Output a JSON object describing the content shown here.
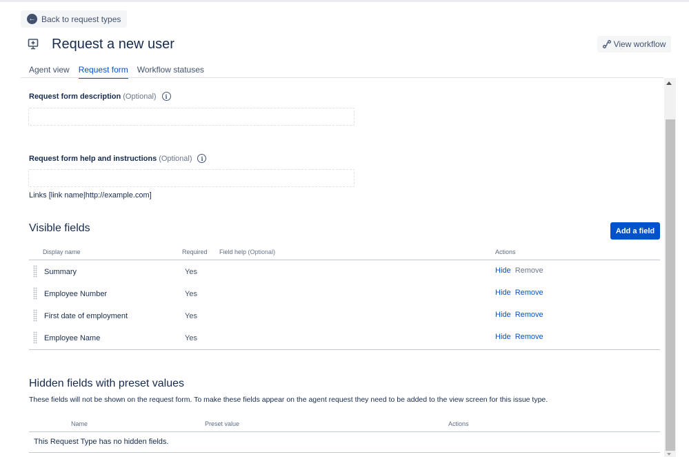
{
  "nav": {
    "back_label": "Back to request types"
  },
  "header": {
    "title": "Request a new user",
    "title_icon": "monitor-plus-icon",
    "view_workflow_label": "View workflow"
  },
  "tabs": [
    {
      "label": "Agent view",
      "active": false
    },
    {
      "label": "Request form",
      "active": true
    },
    {
      "label": "Workflow statuses",
      "active": false
    }
  ],
  "form": {
    "description_label": "Request form description",
    "description_optional": "(Optional)",
    "description_value": "",
    "help_label": "Request form help and instructions",
    "help_optional": "(Optional)",
    "help_value": "",
    "links_hint": "Links [link name|http://example.com]"
  },
  "visible_fields": {
    "heading": "Visible fields",
    "add_button": "Add a field",
    "columns": {
      "display_name": "Display name",
      "required": "Required",
      "field_help": "Field help",
      "field_help_optional": "(Optional)",
      "actions": "Actions"
    },
    "rows": [
      {
        "name": "Summary",
        "required": "Yes",
        "hide": "Hide",
        "remove": "Remove",
        "remove_enabled": false
      },
      {
        "name": "Employee Number",
        "required": "Yes",
        "hide": "Hide",
        "remove": "Remove",
        "remove_enabled": true
      },
      {
        "name": "First date of employment",
        "required": "Yes",
        "hide": "Hide",
        "remove": "Remove",
        "remove_enabled": true
      },
      {
        "name": "Employee Name",
        "required": "Yes",
        "hide": "Hide",
        "remove": "Remove",
        "remove_enabled": true
      }
    ]
  },
  "hidden_fields": {
    "heading": "Hidden fields with preset values",
    "description": "These fields will not be shown on the request form. To make these fields appear on the agent request they need to be added to the view screen for this issue type.",
    "columns": {
      "name": "Name",
      "preset_value": "Preset value",
      "actions": "Actions"
    },
    "empty_message": "This Request Type has no hidden fields."
  },
  "colors": {
    "primary": "#0052cc",
    "text": "#172b4d",
    "muted": "#6b778c"
  }
}
